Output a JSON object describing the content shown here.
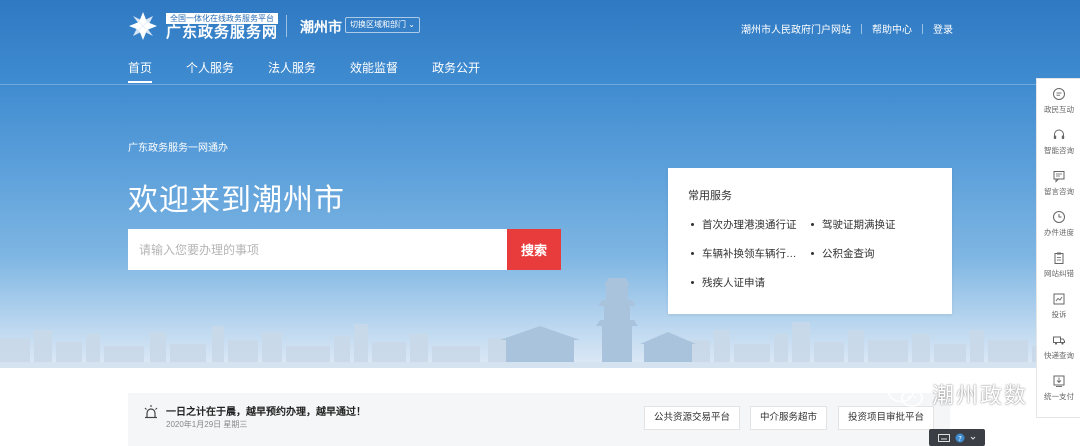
{
  "header": {
    "portal_badge": "全国一体化在线政务服务平台",
    "portal_title": "广东政务服务网",
    "city": "潮州市",
    "switch_region": "切换区域和部门",
    "links": [
      "潮州市人民政府门户网站",
      "帮助中心",
      "登录"
    ]
  },
  "nav": {
    "items": [
      "首页",
      "个人服务",
      "法人服务",
      "效能监督",
      "政务公开"
    ],
    "active_index": 0
  },
  "hero": {
    "slogan": "广东政务服务一网通办",
    "welcome": "欢迎来到潮州市",
    "search_placeholder": "请输入您要办理的事项",
    "search_button": "搜索"
  },
  "common_services": {
    "title": "常用服务",
    "items": [
      "首次办理港澳通行证",
      "驾驶证期满换证",
      "车辆补换领车辆行驶证",
      "公积金查询",
      "残疾人证申请"
    ]
  },
  "side_toolbar": {
    "items": [
      {
        "label": "政民互动",
        "icon": "chat-bubble-icon"
      },
      {
        "label": "智能咨询",
        "icon": "headset-icon"
      },
      {
        "label": "留言咨询",
        "icon": "message-icon"
      },
      {
        "label": "办件进度",
        "icon": "clock-icon"
      },
      {
        "label": "网站纠错",
        "icon": "clipboard-icon"
      },
      {
        "label": "投诉",
        "icon": "complaint-icon"
      },
      {
        "label": "快递查询",
        "icon": "truck-icon"
      },
      {
        "label": "统一支付",
        "icon": "payment-icon"
      }
    ]
  },
  "notice": {
    "text": "一日之计在于晨，越早预约办理，越早通过！",
    "date": "2020年1月29日 星期三",
    "platforms": [
      "公共资源交易平台",
      "中介服务超市",
      "投资项目审批平台"
    ]
  },
  "watermark": {
    "text": "潮州政数"
  },
  "colors": {
    "accent_red": "#e83b3b",
    "hero_blue": "#3f8bd0"
  }
}
